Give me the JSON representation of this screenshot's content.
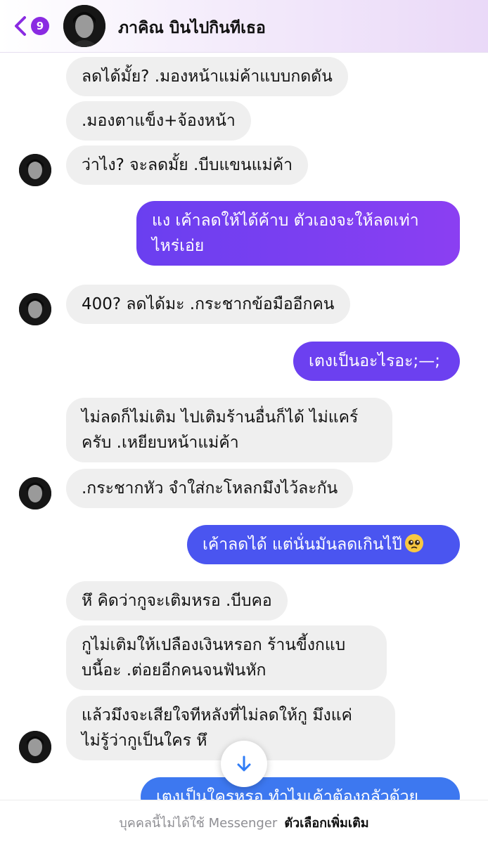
{
  "header": {
    "back_count": "9",
    "contact_name": "ภาคิณ บินไปกินทีเธอ"
  },
  "messages": [
    {
      "text": "ลดได้มั้ย? .มองหน้าแม่ค้าแบบกดดัน"
    },
    {
      "text": ".มองตาแข็ง+จ้องหน้า"
    },
    {
      "text": "ว่าไง? จะลดมั้ย .บีบแขนแม่ค้า"
    },
    {
      "line1": "แง เค้าลดให้ได้ค้าบ ตัวเองจะให้ลดเท่า",
      "line2": "ไหร่เอ่ย"
    },
    {
      "text": "400? ลดได้มะ .กระชากข้อมืออีกคน"
    },
    {
      "text": "เตงเป็นอะไรอะ;—;"
    },
    {
      "line1": "ไม่ลดก็ไม่เติม ไปเติมร้านอื่นก็ได้ ไม่แคร์",
      "line2": "ครับ .เหยียบหน้าแม่ค้า"
    },
    {
      "text": ".กระชากหัว จำใส่กะโหลกมึงไว้ละกัน"
    },
    {
      "text": "เค้าลดได้ แต่นั่นมันลดเกินไป๊"
    },
    {
      "text": "หึ คิดว่ากูจะเติมหรอ .บีบคอ"
    },
    {
      "line1": "กูไม่เติมให้เปลืองเงินหรอก ร้านขี้งกแบ",
      "line2": "บนี้อะ .ต่อยอีกคนจนฟันหัก"
    },
    {
      "line1": "แล้วมึงจะเสียใจทีหลังที่ไม่ลดให้กู มึงแค่",
      "line2": "ไม่รู้ว่ากูเป็นใคร หึ"
    },
    {
      "text": "เตงเป็นใครหรอ ทำไมเค้าต้องกลัวด้วย"
    }
  ],
  "footer": {
    "notice": "บุคคลนี้ไม่ได้ใช้ Messenger",
    "more_options": "ตัวเลือกเพิ่มเติม"
  },
  "colors": {
    "accent": "#8a2be2",
    "incoming_bubble": "#efefef",
    "outgoing_purple": "#7b3ff2",
    "outgoing_blue": "#3f5ef0"
  },
  "icons": {
    "back": "chevron-left-icon",
    "scroll": "arrow-down-icon",
    "emoji": "pleading-face-icon"
  }
}
